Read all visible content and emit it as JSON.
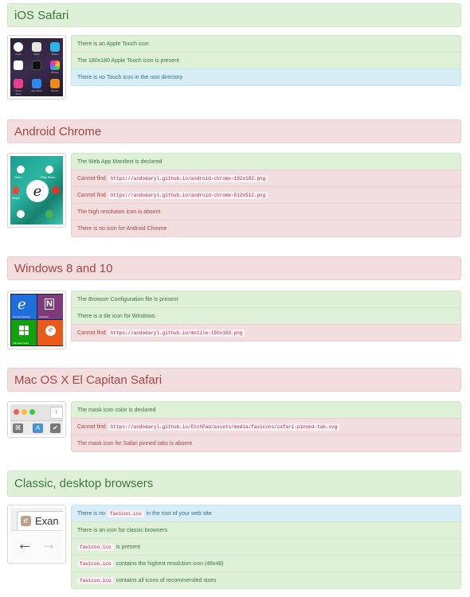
{
  "sections": {
    "ios": {
      "title": "iOS Safari",
      "items": [
        {
          "text": "There is an Apple Touch icon"
        },
        {
          "text": "The 180x180 Apple Touch icon is present"
        },
        {
          "text": "There is no Touch icon in the root directory"
        }
      ],
      "thumb_labels": [
        "Clock",
        "Maps",
        "Videos",
        "",
        "",
        "Photos",
        "iTunes Store",
        "App Store",
        "iBooks"
      ]
    },
    "android": {
      "title": "Android Chrome",
      "items": [
        {
          "text": "The Web App Manifest is declared"
        },
        {
          "pre": "Cannot find",
          "code": "https://andodaryl.github.io/android-chrome-192x192.png"
        },
        {
          "pre": "Cannot find",
          "code": "https://andodaryl.github.io/android-chrome-512x512.png"
        },
        {
          "text": "The high resolution icon is absent"
        },
        {
          "text": "There is no icon for Android Chrome"
        }
      ],
      "thumb_labels": [
        "Drive",
        "Play Store",
        "Maps"
      ]
    },
    "windows": {
      "title": "Windows 8 and 10",
      "items": [
        {
          "text": "The Browser Configuration file is present"
        },
        {
          "text": "There is a tile icon for Windows"
        },
        {
          "pre": "Cannot find",
          "code": "https://andodaryl.github.io/mstile-150x150.png"
        }
      ],
      "thumb_labels": [
        "Internet Explorer",
        "OneNote",
        "Windows Store",
        ""
      ]
    },
    "mac": {
      "title": "Mac OS X El Capitan Safari",
      "items": [
        {
          "text": "The mask icon color is declared"
        },
        {
          "pre": "Cannot find",
          "code": "https://andodaryl.github.io/EtchPad/assets/media/favicons/safari-pinned-tab.svg"
        },
        {
          "text": "The mask icon for Safari pinned tabs is absent"
        }
      ]
    },
    "classic": {
      "title": "Classic, desktop browsers",
      "items": [
        {
          "pre": "There is no",
          "code": "favicon.ico",
          "post": "in the root of your web site"
        },
        {
          "text": "There is an icon for classic browsers"
        },
        {
          "code": "favicon.ico",
          "post": "is present"
        },
        {
          "code": "favicon.ico",
          "post": "contains the highest resolution icon (48x48)"
        },
        {
          "code": "favicon.ico",
          "post": "contains all icons of recommended sizes"
        }
      ],
      "tab_text": "Exan"
    }
  },
  "colors": {
    "success_bg": "#dff0d8",
    "danger_bg": "#f2dede",
    "info_bg": "#d9edf7",
    "ie_blue": "#1e6fd9",
    "onenote_purple": "#80397b",
    "store_green": "#13a10e",
    "orange": "#e8591a"
  }
}
